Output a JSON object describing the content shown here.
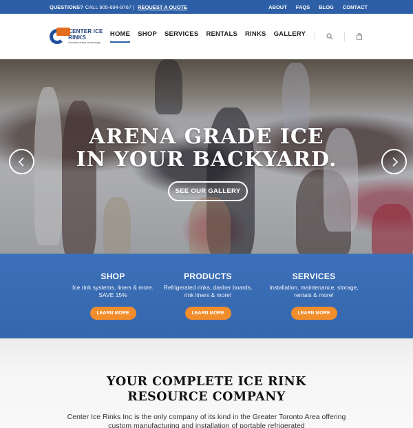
{
  "topbar": {
    "questions_label": "QUESTIONS?",
    "phone": "CALL 905-694-9767 |",
    "quote_link": "REQUEST A QUOTE",
    "links": [
      "ABOUT",
      "FAQS",
      "BLOG",
      "CONTACT"
    ]
  },
  "header": {
    "logo_name": "CENTER ICE RINKS",
    "logo_tagline": "Portable arena technology",
    "nav": [
      "HOME",
      "SHOP",
      "SERVICES",
      "RENTALS",
      "RINKS",
      "GALLERY"
    ],
    "active_nav": "HOME"
  },
  "hero": {
    "title_line1": "ARENA GRADE ICE",
    "title_line2": "IN YOUR BACKYARD.",
    "button": "SEE OUR GALLERY",
    "prev_arrow": "‹",
    "next_arrow": "›"
  },
  "features": [
    {
      "title": "SHOP",
      "text": "Ice rink systems, liners & more. SAVE 15%",
      "button": "LEARN MORE"
    },
    {
      "title": "PRODUCTS",
      "text": "Refrigerated rinks, dasher boards, rink liners & more!",
      "button": "LEARN MORE"
    },
    {
      "title": "SERVICES",
      "text": "Installation, maintenance, storage, rentals & more!",
      "button": "LEARN MORE"
    }
  ],
  "intro": {
    "heading_line1": "YOUR COMPLETE ICE RINK",
    "heading_line2": "RESOURCE COMPANY",
    "body": "Center Ice Rinks Inc is the only company of its kind in the Greater Toronto Area offering custom manufacturing and installation of portable refrigerated"
  },
  "colors": {
    "topbar": "#2d5fa6",
    "band": "#3c70b8",
    "accent_orange": "#f28d2c",
    "logo_blue": "#1f4e9c",
    "logo_orange": "#e46c1f"
  },
  "icons": [
    "search-icon",
    "cart-icon",
    "chevron-left-icon",
    "chevron-right-icon"
  ]
}
